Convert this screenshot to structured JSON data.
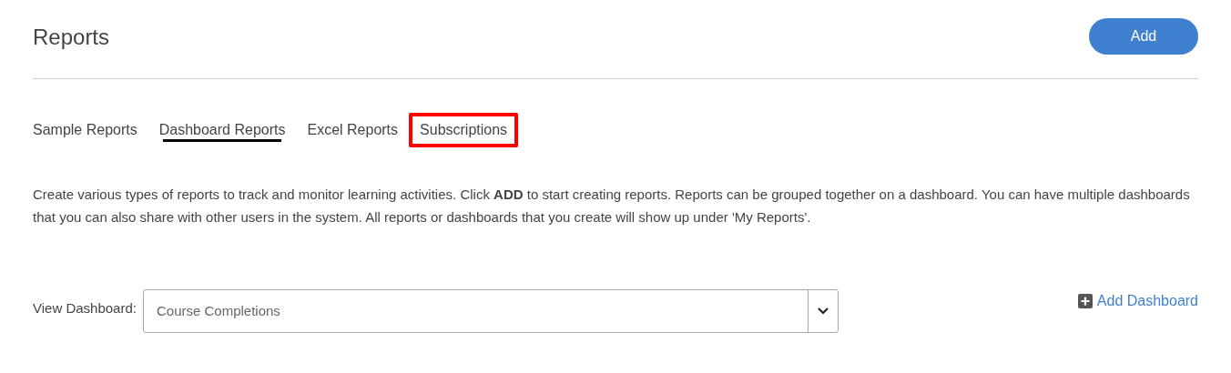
{
  "header": {
    "title": "Reports",
    "add_button": "Add"
  },
  "tabs": [
    {
      "label": "Sample Reports",
      "selected": false,
      "highlighted": false
    },
    {
      "label": "Dashboard Reports",
      "selected": true,
      "highlighted": false
    },
    {
      "label": "Excel Reports",
      "selected": false,
      "highlighted": false
    },
    {
      "label": "Subscriptions",
      "selected": false,
      "highlighted": true
    }
  ],
  "description": "Create various types of reports to track and monitor learning activities. Click **ADD** to start creating reports. Reports can be grouped together on a dashboard. You can have multiple dashboards that you can also share with other users in the system. All reports or dashboards that you create will show up under 'My Reports'.",
  "dashboard": {
    "label": "View Dashboard:",
    "value": "Course Completions",
    "add_link": "Add Dashboard"
  }
}
